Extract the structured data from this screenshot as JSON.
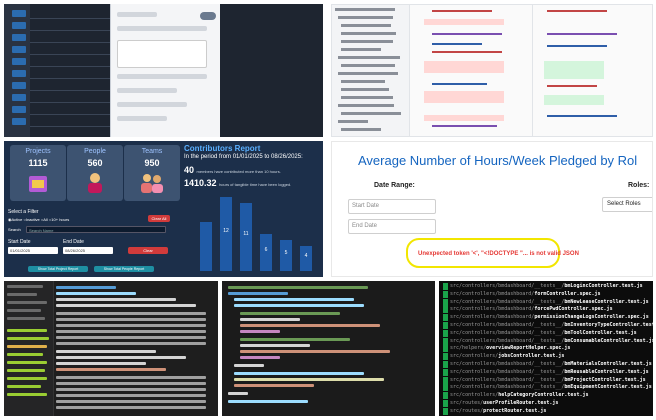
{
  "tile_admin": {
    "note": "Blurred user management table with side form"
  },
  "tile_diff": {
    "note": "Code diff view"
  },
  "tile_report": {
    "stats": [
      {
        "label": "Projects",
        "value": "1115"
      },
      {
        "label": "People",
        "value": "560"
      },
      {
        "label": "Teams",
        "value": "950"
      }
    ],
    "title": "Contributors Report",
    "period": "In the period from 01/01/2025 to 08/26/2025:",
    "members_count": "40",
    "members_text": "members have contributed more than 10 hours.",
    "hours_total": "1410.32",
    "hours_text": "hours of tangible time have been logged.",
    "filter_label": "Select a Filter",
    "filter_options": [
      "Active",
      "Inactive",
      "All",
      "10+ hours"
    ],
    "clear_all": "Clear All",
    "search_label": "Search",
    "search_placeholder": "Search Name",
    "start_date_label": "Start Date",
    "start_date_value": "01/01/2025",
    "end_date_label": "End Date",
    "end_date_value": "08/26/2025",
    "clear": "Clear",
    "btn_projects": "Show Total Project Report",
    "btn_people": "Show Total People Report",
    "bars": [
      {
        "label": "",
        "value": 8
      },
      {
        "label": "12",
        "value": 12
      },
      {
        "label": "11",
        "value": 11
      },
      {
        "label": "6",
        "value": 6
      },
      {
        "label": "5",
        "value": 5
      },
      {
        "label": "4",
        "value": 4
      }
    ]
  },
  "tile_pledged": {
    "title": "Average Number of Hours/Week Pledged by Rol",
    "date_range_label": "Date Range:",
    "roles_label": "Roles:",
    "start_placeholder": "Start Date",
    "end_placeholder": "End Date",
    "roles_select": "Select Roles",
    "error": "Unexpected token '<', \"<!DOCTYPE \"... is not valid JSON"
  },
  "tile_tests": {
    "lines": [
      "src/controllers/bmdashboard/__tests__/bmLogincController.test.js",
      "src/controllers/bmdashboard/formController.spec.js",
      "src/controllers/bmdashboard/__tests__/bmNewLeaseController.test.js",
      "src/controllers/bmdashboard/forcePwdController.spec.js",
      "src/controllers/bmdashboard/permissionChangeLogsController.spec.js",
      "src/controllers/bmdashboard/__tests__/bmInventoryTypeController.test.js",
      "src/controllers/bmdashboard/__tests__/bmToolController.test.js",
      "src/controllers/bmdashboard/__tests__/bmConsumableController.test.js",
      "src/helpers/overviewReportHelper.spec.js",
      "src/controllers/jobsController.test.js",
      "src/controllers/bmdashboard/__tests__/bmMaterialsController.test.js",
      "src/controllers/bmdashboard/__tests__/bmReusableController.test.js",
      "src/controllers/bmdashboard/__tests__/bmProjectController.test.js",
      "src/controllers/bmdashboard/__tests__/bmEquipmentController.test.js",
      "src/controllers/helpCategoryController.test.js",
      "src/routes/userProfileRouter.test.js",
      "src/routes/protectRouter.test.js"
    ]
  }
}
